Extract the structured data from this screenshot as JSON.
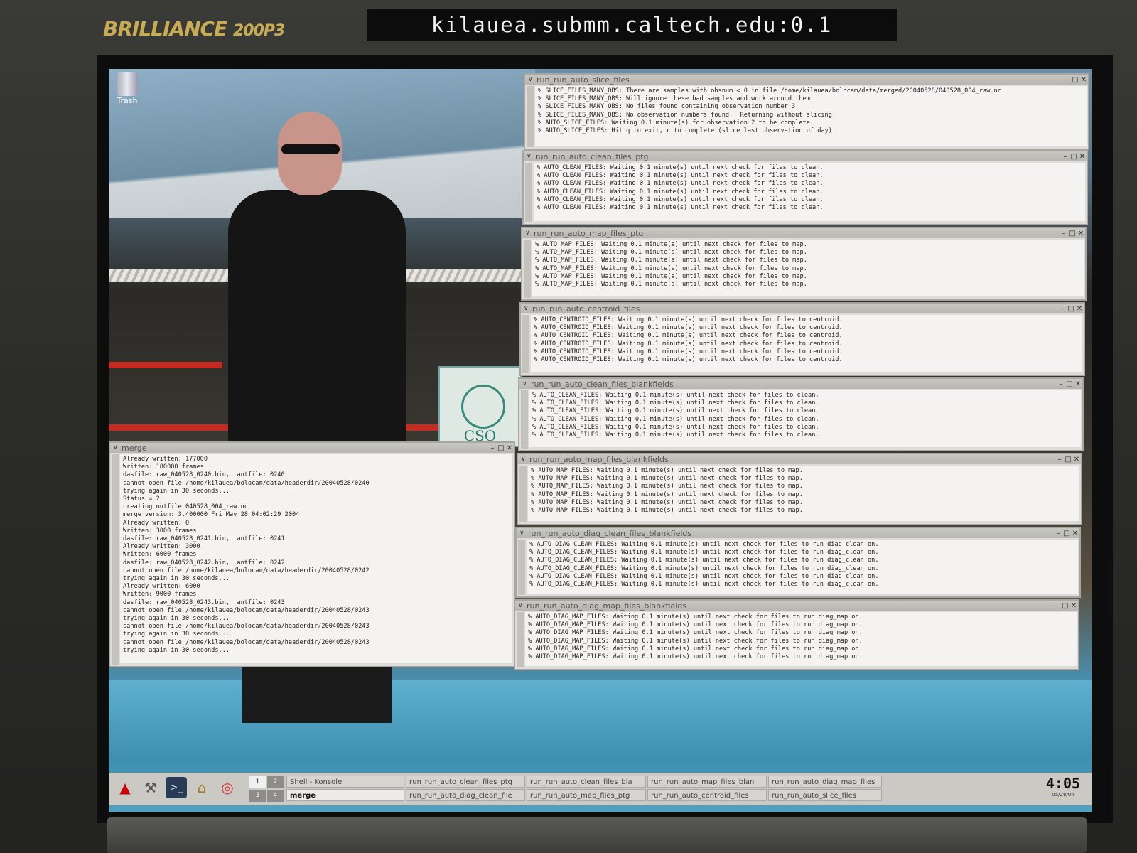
{
  "monitor": {
    "brand": "BRILLIANCE",
    "model": "200P3",
    "host_label": "kilauea.submm.caltech.edu:0.1"
  },
  "desktop": {
    "trash_label": "Trash",
    "sign_text": "CSO"
  },
  "windows": {
    "slice": {
      "title": "run_run_auto_slice_files",
      "lines": [
        "% SLICE_FILES_MANY_OBS: There are samples with obsnum < 0 in file /home/kilauea/bolocam/data/merged/20040528/040528_004_raw.nc",
        "% SLICE_FILES_MANY_OBS: Will ignore these bad samples and work around them.",
        "% SLICE_FILES_MANY_OBS: No files found containing observation number 3",
        "% SLICE_FILES_MANY_OBS: No observation numbers found.  Returning without slicing.",
        "% AUTO_SLICE_FILES: Waiting 0.1 minute(s) for observation 2 to be complete.",
        "% AUTO_SLICE_FILES: Hit q to exit, c to complete (slice last observation of day)."
      ]
    },
    "clean_ptg": {
      "title": "run_run_auto_clean_files_ptg",
      "lines": [
        "% AUTO_CLEAN_FILES: Waiting 0.1 minute(s) until next check for files to clean.",
        "% AUTO_CLEAN_FILES: Waiting 0.1 minute(s) until next check for files to clean.",
        "% AUTO_CLEAN_FILES: Waiting 0.1 minute(s) until next check for files to clean.",
        "% AUTO_CLEAN_FILES: Waiting 0.1 minute(s) until next check for files to clean.",
        "% AUTO_CLEAN_FILES: Waiting 0.1 minute(s) until next check for files to clean.",
        "% AUTO_CLEAN_FILES: Waiting 0.1 minute(s) until next check for files to clean."
      ]
    },
    "map_ptg": {
      "title": "run_run_auto_map_files_ptg",
      "lines": [
        "% AUTO_MAP_FILES: Waiting 0.1 minute(s) until next check for files to map.",
        "% AUTO_MAP_FILES: Waiting 0.1 minute(s) until next check for files to map.",
        "% AUTO_MAP_FILES: Waiting 0.1 minute(s) until next check for files to map.",
        "% AUTO_MAP_FILES: Waiting 0.1 minute(s) until next check for files to map.",
        "% AUTO_MAP_FILES: Waiting 0.1 minute(s) until next check for files to map.",
        "% AUTO_MAP_FILES: Waiting 0.1 minute(s) until next check for files to map."
      ]
    },
    "centroid": {
      "title": "run_run_auto_centroid_files",
      "lines": [
        "% AUTO_CENTROID_FILES: Waiting 0.1 minute(s) until next check for files to centroid.",
        "% AUTO_CENTROID_FILES: Waiting 0.1 minute(s) until next check for files to centroid.",
        "% AUTO_CENTROID_FILES: Waiting 0.1 minute(s) until next check for files to centroid.",
        "% AUTO_CENTROID_FILES: Waiting 0.1 minute(s) until next check for files to centroid.",
        "% AUTO_CENTROID_FILES: Waiting 0.1 minute(s) until next check for files to centroid.",
        "% AUTO_CENTROID_FILES: Waiting 0.1 minute(s) until next check for files to centroid."
      ]
    },
    "clean_blank": {
      "title": "run_run_auto_clean_files_blankfields",
      "lines": [
        "% AUTO_CLEAN_FILES: Waiting 0.1 minute(s) until next check for files to clean.",
        "% AUTO_CLEAN_FILES: Waiting 0.1 minute(s) until next check for files to clean.",
        "% AUTO_CLEAN_FILES: Waiting 0.1 minute(s) until next check for files to clean.",
        "% AUTO_CLEAN_FILES: Waiting 0.1 minute(s) until next check for files to clean.",
        "% AUTO_CLEAN_FILES: Waiting 0.1 minute(s) until next check for files to clean.",
        "% AUTO_CLEAN_FILES: Waiting 0.1 minute(s) until next check for files to clean."
      ]
    },
    "map_blank": {
      "title": "run_run_auto_map_files_blankfields",
      "lines": [
        "% AUTO_MAP_FILES: Waiting 0.1 minute(s) until next check for files to map.",
        "% AUTO_MAP_FILES: Waiting 0.1 minute(s) until next check for files to map.",
        "% AUTO_MAP_FILES: Waiting 0.1 minute(s) until next check for files to map.",
        "% AUTO_MAP_FILES: Waiting 0.1 minute(s) until next check for files to map.",
        "% AUTO_MAP_FILES: Waiting 0.1 minute(s) until next check for files to map.",
        "% AUTO_MAP_FILES: Waiting 0.1 minute(s) until next check for files to map."
      ]
    },
    "diag_clean": {
      "title": "run_run_auto_diag_clean_files_blankfields",
      "lines": [
        "% AUTO_DIAG_CLEAN_FILES: Waiting 0.1 minute(s) until next check for files to run diag_clean on.",
        "% AUTO_DIAG_CLEAN_FILES: Waiting 0.1 minute(s) until next check for files to run diag_clean on.",
        "% AUTO_DIAG_CLEAN_FILES: Waiting 0.1 minute(s) until next check for files to run diag_clean on.",
        "% AUTO_DIAG_CLEAN_FILES: Waiting 0.1 minute(s) until next check for files to run diag_clean on.",
        "% AUTO_DIAG_CLEAN_FILES: Waiting 0.1 minute(s) until next check for files to run diag_clean on.",
        "% AUTO_DIAG_CLEAN_FILES: Waiting 0.1 minute(s) until next check for files to run diag_clean on."
      ]
    },
    "diag_map": {
      "title": "run_run_auto_diag_map_files_blankfields",
      "lines": [
        "% AUTO_DIAG_MAP_FILES: Waiting 0.1 minute(s) until next check for files to run diag_map on.",
        "% AUTO_DIAG_MAP_FILES: Waiting 0.1 minute(s) until next check for files to run diag_map on.",
        "% AUTO_DIAG_MAP_FILES: Waiting 0.1 minute(s) until next check for files to run diag_map on.",
        "% AUTO_DIAG_MAP_FILES: Waiting 0.1 minute(s) until next check for files to run diag_map on.",
        "% AUTO_DIAG_MAP_FILES: Waiting 0.1 minute(s) until next check for files to run diag_map on.",
        "% AUTO_DIAG_MAP_FILES: Waiting 0.1 minute(s) until next check for files to run diag_map on."
      ]
    },
    "merge": {
      "title": "merge",
      "lines": [
        "Already written: 177000",
        "Written: 180000 frames",
        "dasfile: raw_040528_0240.bin,  antfile: 0240",
        "cannot open file /home/kilauea/bolocam/data/headerdir/20040528/0240",
        "trying again in 30 seconds...",
        "Status = 2",
        "creating outfile 040528_004_raw.nc",
        "merge version: 3.400000 Fri May 28 04:02:29 2004",
        "Already written: 0",
        "Written: 3000 frames",
        "dasfile: raw_040528_0241.bin,  antfile: 0241",
        "Already written: 3000",
        "Written: 6000 frames",
        "dasfile: raw_040528_0242.bin,  antfile: 0242",
        "cannot open file /home/kilauea/bolocam/data/headerdir/20040528/0242",
        "trying again in 30 seconds...",
        "Already written: 6000",
        "Written: 9000 frames",
        "dasfile: raw_040528_0243.bin,  antfile: 0243",
        "cannot open file /home/kilauea/bolocam/data/headerdir/20040528/0243",
        "trying again in 30 seconds...",
        "cannot open file /home/kilauea/bolocam/data/headerdir/20040528/0243",
        "trying again in 30 seconds...",
        "cannot open file /home/kilauea/bolocam/data/headerdir/20040528/0243",
        "trying again in 30 seconds..."
      ]
    }
  },
  "taskbar": {
    "pager": [
      "1",
      "2",
      "3",
      "4"
    ],
    "tasks_row1": [
      "Shell - Konsole",
      "run_run_auto_clean_files_ptg",
      "run_run_auto_clean_files_bla",
      "run_run_auto_map_files_blan",
      "run_run_auto_diag_map_files"
    ],
    "tasks_row2": [
      "merge",
      "run_run_auto_diag_clean_file",
      "run_run_auto_map_files_ptg",
      "run_run_auto_centroid_files",
      "run_run_auto_slice_files"
    ],
    "clock_time": "4:05",
    "clock_date": "05/28/04"
  },
  "colors": {
    "konsole_bg": "#f4f3f1",
    "titlebar": "#c2c0bb",
    "rail_red": "#c42b23",
    "floor_blue": "#4fa2c2"
  }
}
